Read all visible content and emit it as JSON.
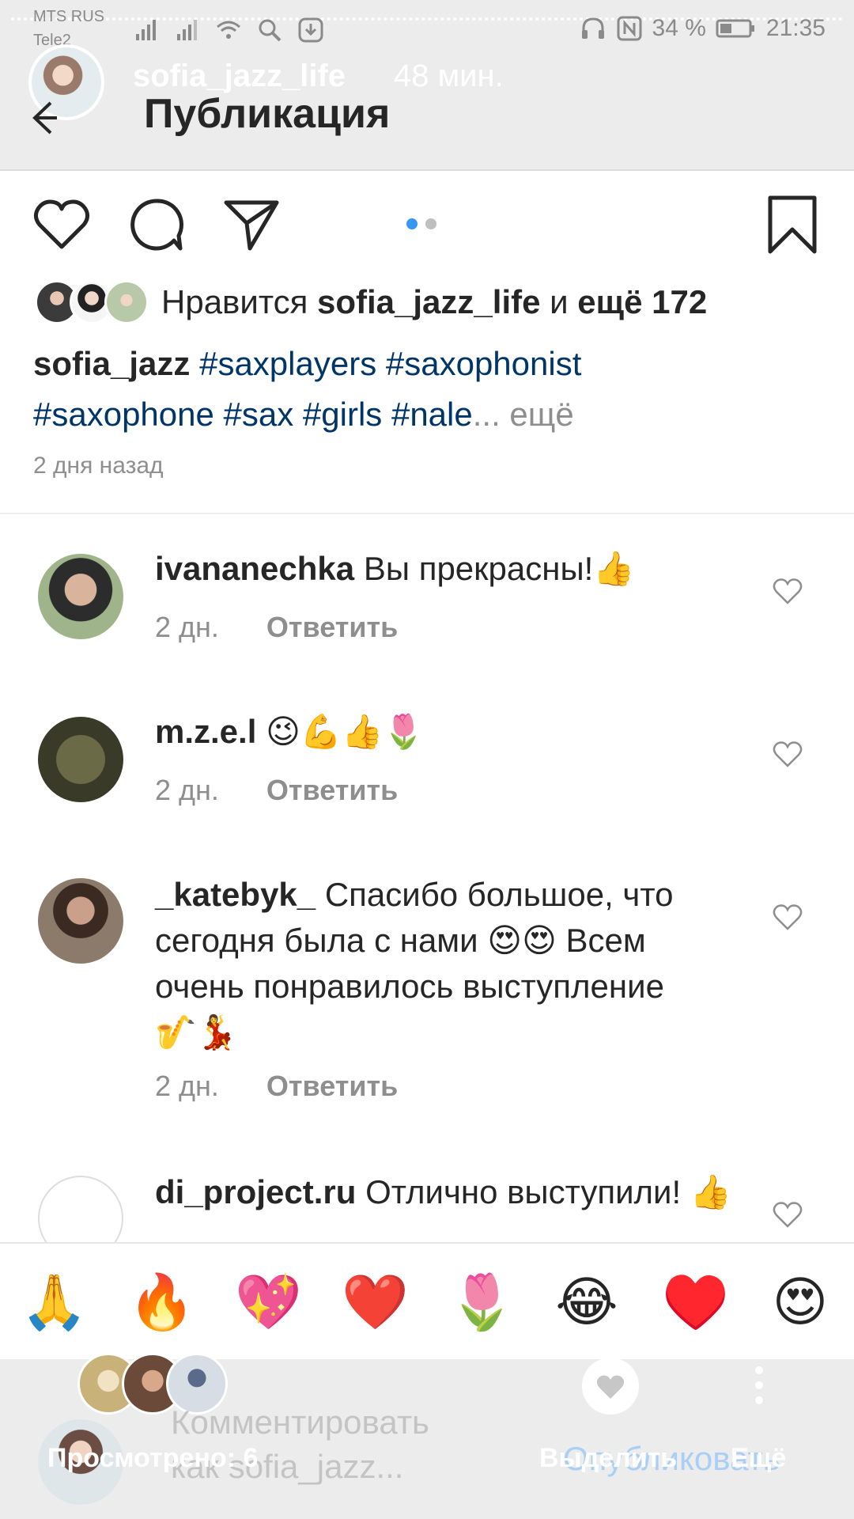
{
  "status_bar": {
    "carrier_1": "MTS RUS",
    "carrier_2": "Tele2",
    "battery": "34 %",
    "time": "21:35"
  },
  "story_overlay": {
    "username": "sofia_jazz_life",
    "time": "48 мин.",
    "viewed": "Просмотрено: 6",
    "highlight": "Выделить",
    "more": "Ещё"
  },
  "header": {
    "title": "Публикация"
  },
  "post": {
    "likes_prefix": "Нравится ",
    "likes_user": "sofia_jazz_life",
    "likes_mid": " и ",
    "likes_count": "ещё 172",
    "caption_user": "sofia_jazz",
    "caption_tags_line1": "#saxplayers #saxophonist",
    "caption_tags_line2": "#saxophone #sax #girls #nale",
    "caption_ellipsis": "...",
    "caption_more": " ещё",
    "time_ago": "2 дня назад",
    "carousel_pages": 2,
    "carousel_active": 1
  },
  "comments": [
    {
      "user": "ivananechka",
      "text": "Вы прекрасны!👍",
      "time": "2 дн.",
      "reply": "Ответить"
    },
    {
      "user": "m.z.e.l",
      "text": "😉💪👍🌷",
      "time": "2 дн.",
      "reply": "Ответить"
    },
    {
      "user": "_katebyk_",
      "text": "Спасибо большое, что сегодня была с нами 😍😍 Всем очень понравилось выступление 🎷💃",
      "time": "2 дн.",
      "reply": "Ответить"
    },
    {
      "user": "di_project.ru",
      "text": "Отлично выступили! 👍",
      "time": "",
      "reply": ""
    }
  ],
  "emoji_bar": [
    "🙏",
    "🔥",
    "💖",
    "❤️",
    "🌷",
    "😂",
    "♥️",
    "😍"
  ],
  "composer": {
    "placeholder_line1": "Комментировать",
    "placeholder_line2": "как sofia_jazz...",
    "publish": "Опубликовать"
  },
  "icons": [
    "back-icon",
    "heart-icon",
    "comment-icon",
    "share-icon",
    "bookmark-icon",
    "wifi-icon",
    "search-icon",
    "headphones-icon",
    "nfc-icon",
    "battery-icon",
    "more-vert-icon"
  ]
}
